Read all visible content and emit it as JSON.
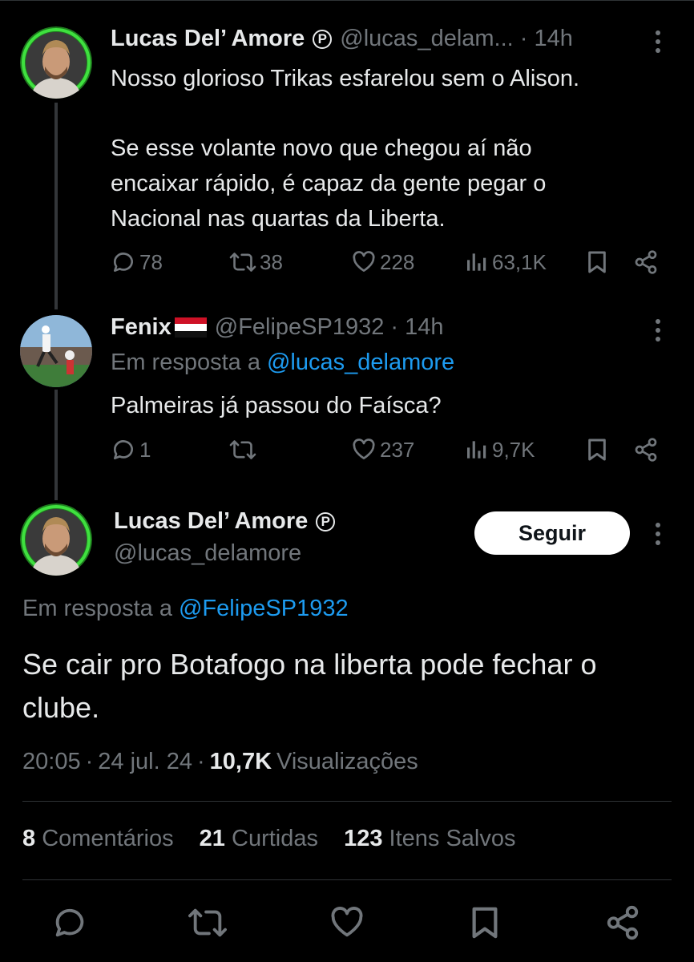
{
  "tweet1": {
    "name": "Lucas Del’ Amore",
    "handle": "@lucas_delam...",
    "time": "· 14h",
    "text_line1": "Nosso glorioso Trikas esfarelou sem o Alison.",
    "text_para2": "Se esse volante novo que chegou aí não\nencaixar rápido, é capaz da gente pegar o\nNacional nas quartas da Liberta.",
    "replies": "78",
    "retweets": "38",
    "likes": "228",
    "views": "63,1K"
  },
  "tweet2": {
    "name": "Fenix",
    "handle": "@FelipeSP1932",
    "time": "· 14h",
    "reply_prefix": "Em resposta a",
    "reply_to": "@lucas_delamore",
    "text": "Palmeiras já passou do Faísca?",
    "replies": "1",
    "likes": "237",
    "views": "9,7K"
  },
  "main_tweet": {
    "name": "Lucas Del’ Amore",
    "handle": "@lucas_delamore",
    "follow_label": "Seguir",
    "reply_prefix": "Em resposta a",
    "reply_to": "@FelipeSP1932",
    "text": "Se cair pro Botafogo na liberta pode fechar o clube.",
    "time": "20:05",
    "date": "24 jul. 24",
    "views_count": "10,7K",
    "views_label": "Visualizações",
    "comments_count": "8",
    "comments_label": "Comentários",
    "likes_count": "21",
    "likes_label": "Curtidas",
    "saves_count": "123",
    "saves_label": "Itens Salvos"
  },
  "icons": [
    "reply-icon",
    "retweet-icon",
    "like-icon",
    "views-icon",
    "bookmark-icon",
    "share-icon",
    "more-icon",
    "verified-p-icon"
  ],
  "colors": {
    "background": "#000000",
    "text": "#e7e9ea",
    "muted": "#71767b",
    "link": "#1d9bf0",
    "button_bg": "#ffffff"
  }
}
